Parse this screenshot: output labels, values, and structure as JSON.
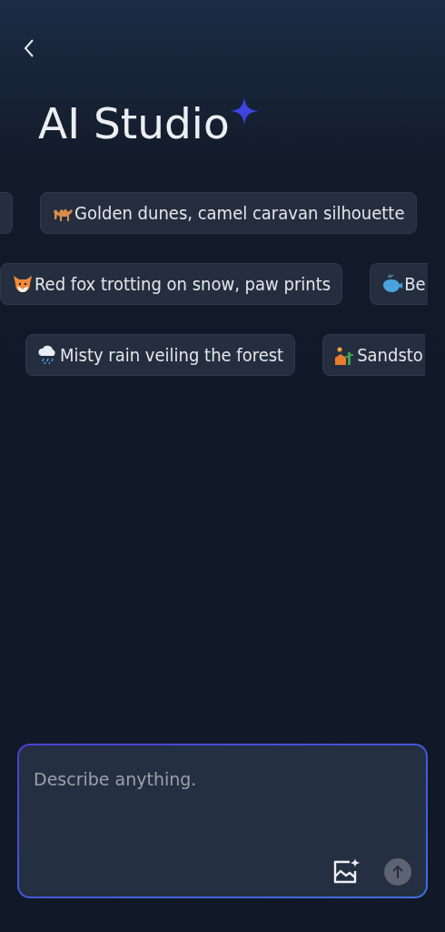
{
  "header": {
    "title": "AI Studio"
  },
  "chip_rows": [
    {
      "lead_cut": true,
      "chips": [
        {
          "label": "Golden dunes, camel caravan silhouette",
          "cut": false
        }
      ]
    },
    {
      "lead_cut": false,
      "chips": [
        {
          "label": "Red fox trotting on snow, paw prints",
          "cut": false
        },
        {
          "label": "Be",
          "cut": true
        }
      ]
    },
    {
      "lead_cut": false,
      "chips": [
        {
          "label": "Misty rain veiling the forest",
          "cut": false
        },
        {
          "label": "Sandsto",
          "cut": true
        }
      ]
    }
  ],
  "prompt": {
    "placeholder": "Describe anything."
  }
}
